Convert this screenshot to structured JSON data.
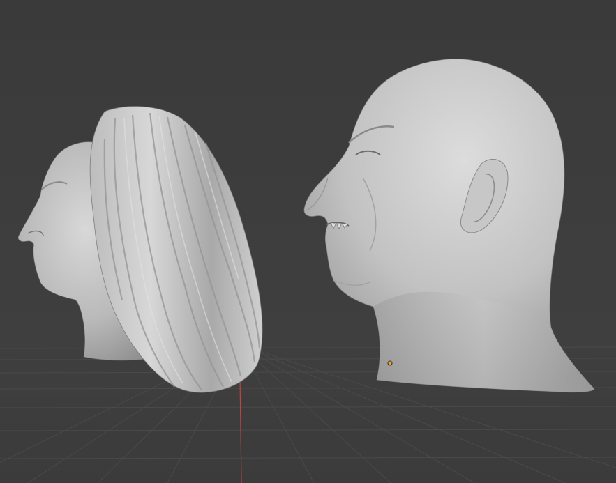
{
  "viewport": {
    "background": "#3d3d3d",
    "grid_color": "#4a4a4a",
    "x_axis_color": "#c04545",
    "origin_color": "#f4a02a"
  },
  "objects": [
    {
      "name": "hair-mesh",
      "kind": "hair"
    },
    {
      "name": "head-with-hair-mesh",
      "kind": "head"
    },
    {
      "name": "bald-head-mesh",
      "kind": "head"
    }
  ]
}
